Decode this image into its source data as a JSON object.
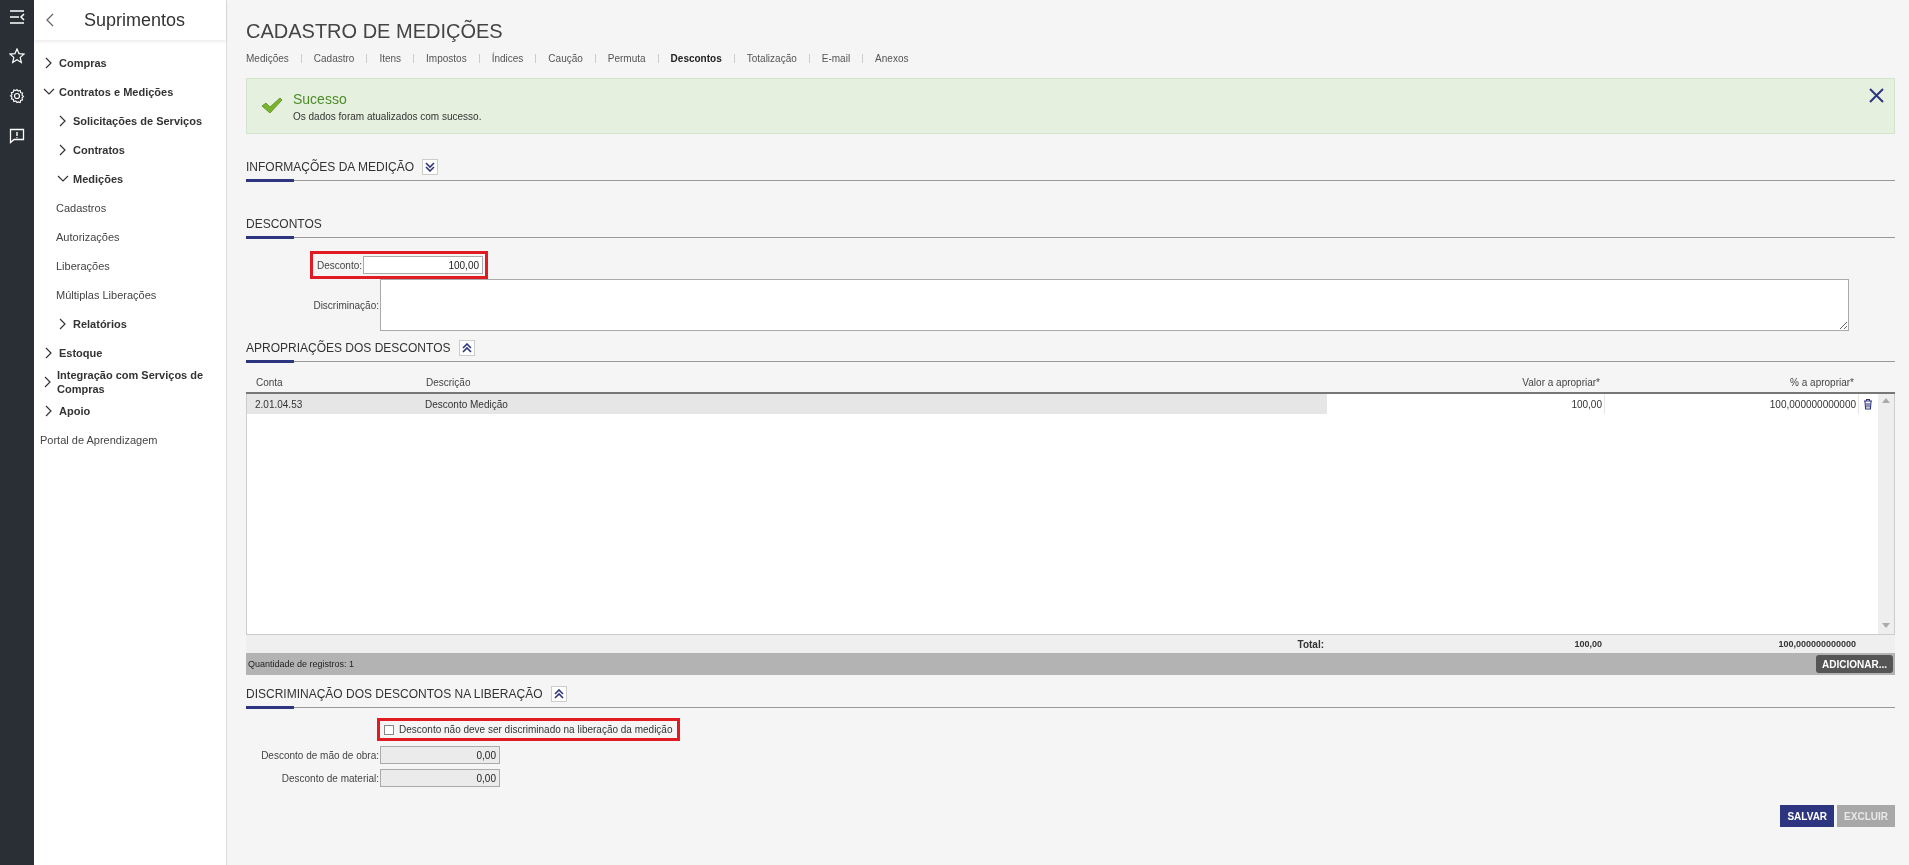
{
  "rail": {
    "items": [
      {
        "kind": "menu"
      },
      {
        "kind": "star"
      },
      {
        "kind": "gear"
      },
      {
        "kind": "feedback"
      }
    ]
  },
  "sidebar": {
    "title": "Suprimentos",
    "items": [
      {
        "label": "Compras",
        "kind": "group",
        "expanded": false
      },
      {
        "label": "Contratos e Medições",
        "kind": "group",
        "expanded": true,
        "children": [
          {
            "label": "Solicitações de Serviços",
            "kind": "group",
            "expanded": false
          },
          {
            "label": "Contratos",
            "kind": "group",
            "expanded": false
          },
          {
            "label": "Medições",
            "kind": "group",
            "expanded": true,
            "children": [
              {
                "label": "Cadastros",
                "kind": "link"
              },
              {
                "label": "Autorizações",
                "kind": "link"
              },
              {
                "label": "Liberações",
                "kind": "link"
              },
              {
                "label": "Múltiplas Liberações",
                "kind": "link"
              }
            ]
          },
          {
            "label": "Relatórios",
            "kind": "group",
            "expanded": false
          }
        ]
      },
      {
        "label": "Estoque",
        "kind": "group",
        "expanded": false
      },
      {
        "label": "Integração com Serviços de Compras",
        "kind": "group",
        "expanded": false
      },
      {
        "label": "Apoio",
        "kind": "group",
        "expanded": false
      },
      {
        "label": "Portal de Aprendizagem",
        "kind": "link"
      }
    ]
  },
  "page": {
    "title": "CADASTRO DE MEDIÇÕES"
  },
  "tabs": [
    {
      "label": "Medições",
      "selected": false
    },
    {
      "label": "Cadastro",
      "selected": false
    },
    {
      "label": "Itens",
      "selected": false
    },
    {
      "label": "Impostos",
      "selected": false
    },
    {
      "label": "Índices",
      "selected": false
    },
    {
      "label": "Caução",
      "selected": false
    },
    {
      "label": "Permuta",
      "selected": false
    },
    {
      "label": "Descontos",
      "selected": true
    },
    {
      "label": "Totalização",
      "selected": false
    },
    {
      "label": "E-mail",
      "selected": false
    },
    {
      "label": "Anexos",
      "selected": false
    }
  ],
  "alert": {
    "title": "Sucesso",
    "message": "Os dados foram atualizados com sucesso."
  },
  "info_section": {
    "title": "INFORMAÇÕES DA MEDIÇÃO",
    "expanded": false
  },
  "discounts": {
    "title": "DESCONTOS",
    "desconto": {
      "label": "Desconto:",
      "value": "100,00",
      "highlighted": true
    },
    "discriminacao": {
      "label": "Discriminação:"
    }
  },
  "appropriations": {
    "title": "APROPRIAÇÕES DOS DESCONTOS",
    "expanded": true,
    "columns": [
      "Conta",
      "Descrição",
      "Valor a apropriar*",
      "% a apropriar*"
    ],
    "rows": [
      {
        "conta": "2.01.04.53",
        "descricao": "Desconto Medição",
        "valor": "100,00",
        "percentual": "100,000000000000"
      }
    ],
    "total": {
      "label": "Total:",
      "valor": "100,00",
      "percentual": "100,000000000000"
    },
    "count": "Quantidade de registros: 1",
    "add_button": "ADICIONAR..."
  },
  "release": {
    "title": "DISCRIMINAÇÃO DOS DESCONTOS NA LIBERAÇÃO",
    "expanded": true,
    "checkbox": {
      "label": "Desconto não deve ser discriminado na liberação da medição",
      "checked": false,
      "highlighted": true
    },
    "fields": [
      {
        "label": "Desconto de mão de obra:",
        "value": "0,00"
      },
      {
        "label": "Desconto de material:",
        "value": "0,00"
      }
    ]
  },
  "buttons": [
    {
      "label": "SALVAR",
      "disabled": false
    },
    {
      "label": "EXCLUIR",
      "disabled": true
    }
  ]
}
